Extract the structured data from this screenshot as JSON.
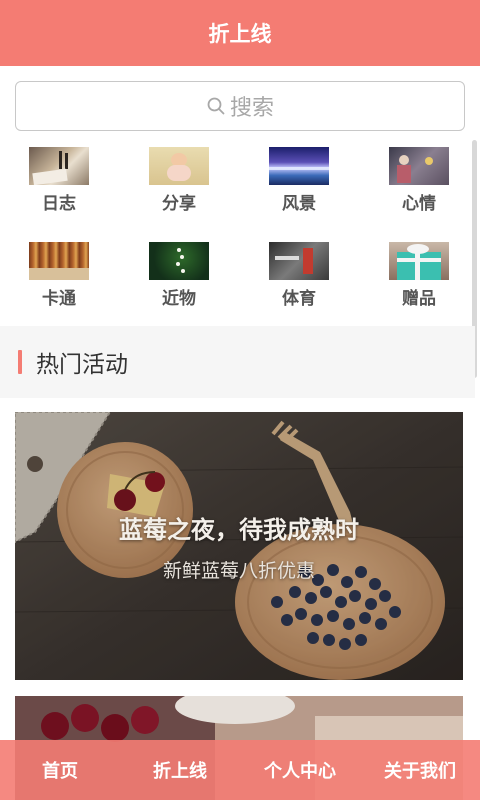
{
  "header": {
    "title": "折上线"
  },
  "search": {
    "placeholder": "搜索",
    "icon": "search-icon"
  },
  "categories": [
    {
      "label": "日志"
    },
    {
      "label": "分享"
    },
    {
      "label": "风景"
    },
    {
      "label": "心情"
    },
    {
      "label": "卡通"
    },
    {
      "label": "近物"
    },
    {
      "label": "体育"
    },
    {
      "label": "赠品"
    }
  ],
  "section": {
    "title": "热门活动"
  },
  "promo": {
    "headline": "蓝莓之夜，待我成熟时",
    "subtitle": "新鲜蓝莓八折优惠"
  },
  "bottom_nav": [
    {
      "label": "首页"
    },
    {
      "label": "折上线"
    },
    {
      "label": "个人中心"
    },
    {
      "label": "关于我们"
    }
  ],
  "colors": {
    "brand": "#f47c73",
    "section_bg": "#f6f6f6"
  }
}
